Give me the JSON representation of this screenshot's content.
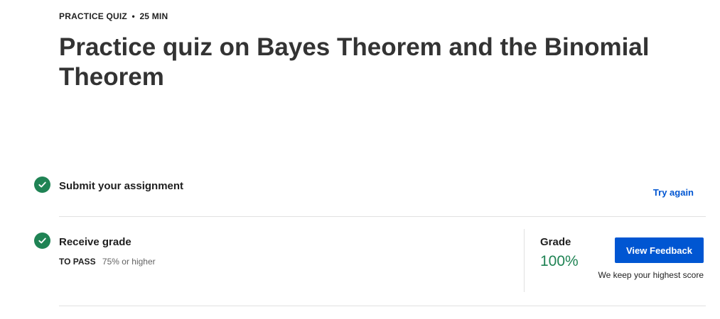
{
  "header": {
    "quiz_type": "PRACTICE QUIZ",
    "separator": "•",
    "duration": "25 MIN",
    "title": "Practice quiz on Bayes Theorem and the Binomial Theorem"
  },
  "steps": [
    {
      "title": "Submit your assignment",
      "status_icon": "check-circle-icon",
      "action_label": "Try again"
    },
    {
      "title": "Receive grade",
      "status_icon": "check-circle-icon",
      "pass_label": "TO PASS",
      "pass_requirement": "75% or higher"
    }
  ],
  "grade": {
    "label": "Grade",
    "value": "100%",
    "button_label": "View Feedback",
    "note": "We keep your highest score"
  },
  "colors": {
    "success": "#1f8354",
    "accent": "#0056d2",
    "divider": "#e1e1e1"
  }
}
